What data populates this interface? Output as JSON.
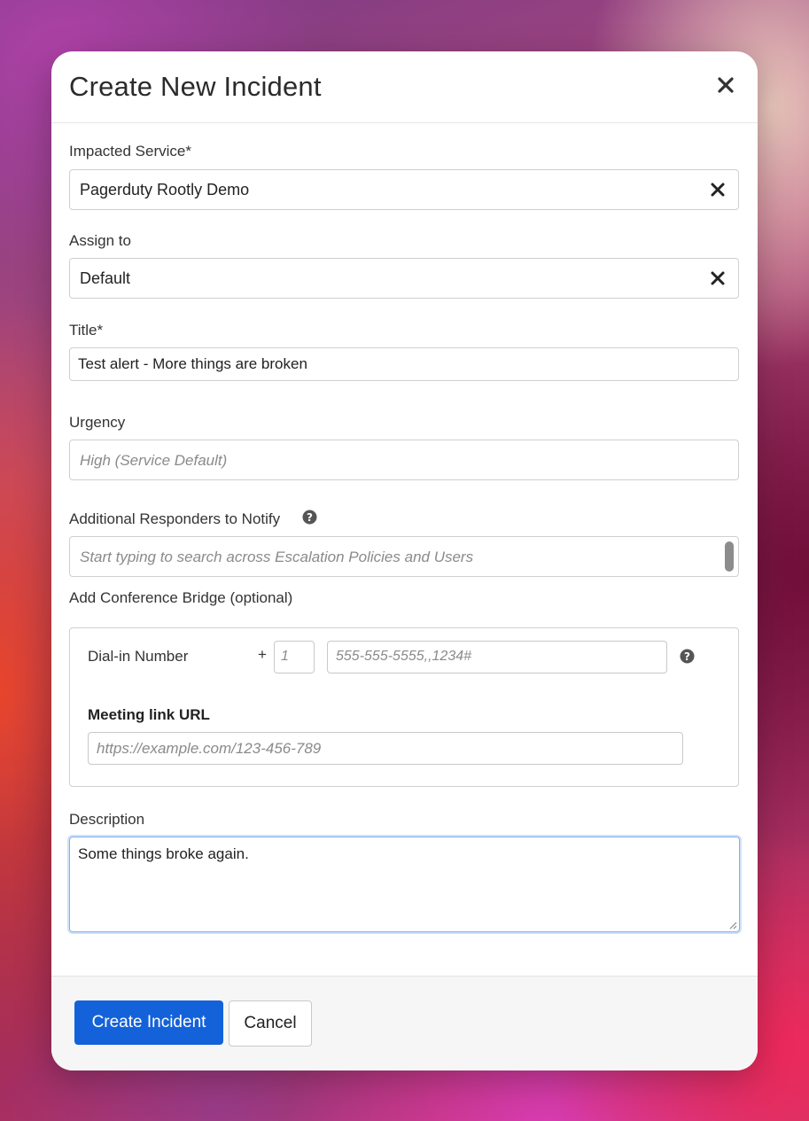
{
  "modal": {
    "title": "Create New Incident"
  },
  "impacted_service": {
    "label": "Impacted Service*",
    "value": "Pagerduty Rootly Demo"
  },
  "assign_to": {
    "label": "Assign to",
    "value": "Default"
  },
  "title_field": {
    "label": "Title*",
    "value": "Test alert - More things are broken"
  },
  "urgency": {
    "label": "Urgency",
    "placeholder": "High (Service Default)"
  },
  "responders": {
    "label": "Additional Responders to Notify",
    "placeholder": "Start typing to search across Escalation Policies and Users"
  },
  "conference_bridge": {
    "label": "Add Conference Bridge (optional)",
    "dial_in_label": "Dial-in Number",
    "plus_sign": "+",
    "country_code_placeholder": "1",
    "number_placeholder": "555-555-5555,,1234#",
    "meeting_link_label": "Meeting link URL",
    "meeting_link_placeholder": "https://example.com/123-456-789"
  },
  "description": {
    "label": "Description",
    "value": "Some things broke again."
  },
  "footer": {
    "create_label": "Create Incident",
    "cancel_label": "Cancel"
  },
  "colors": {
    "primary_button": "#1462d9",
    "focus_border": "#7fb2f0"
  },
  "icons": [
    "close-icon",
    "clear-icon",
    "help-icon",
    "resize-grip-icon"
  ]
}
